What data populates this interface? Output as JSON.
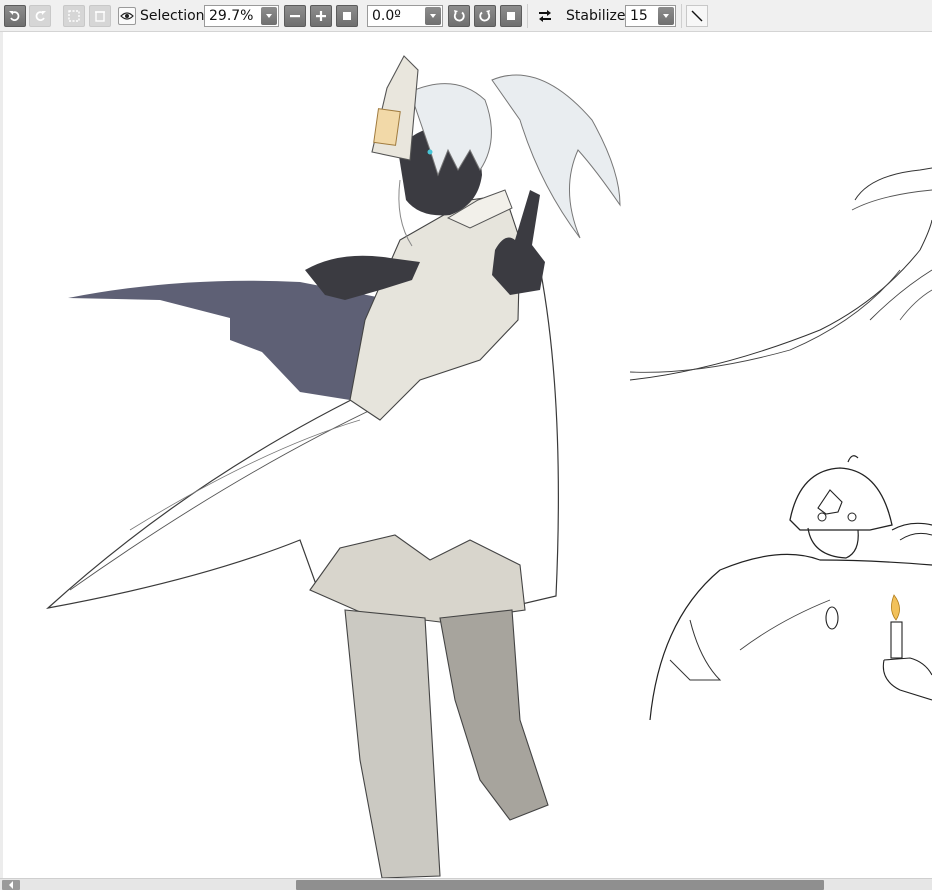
{
  "toolbar": {
    "selection_label": "Selection",
    "zoom_value": "29.7%",
    "rotation_value": "0.0º",
    "stabilizer_label": "Stabilizer",
    "stabilizer_value": "15"
  },
  "icons": {
    "undo": "undo-icon",
    "redo": "redo-icon",
    "deselect": "deselect-icon",
    "clear": "clear-icon",
    "eye": "eye-icon",
    "zoom_out": "minus-icon",
    "zoom_in": "plus-icon",
    "zoom_reset": "square-icon",
    "rotate_left": "rotate-left-icon",
    "rotate_right": "rotate-right-icon",
    "rotate_reset": "square-icon",
    "flip": "flip-arrows-icon",
    "brush": "diagonal-line-icon"
  },
  "colors": {
    "toolbar_bg": "#f0f0f0",
    "button": "#7e7e7e",
    "cape_shadow": "#5e6075",
    "skin": "#3b3b41",
    "cloth": "#e6e4dc",
    "pants": "#cbc9c2",
    "hair": "#e9edf0"
  }
}
